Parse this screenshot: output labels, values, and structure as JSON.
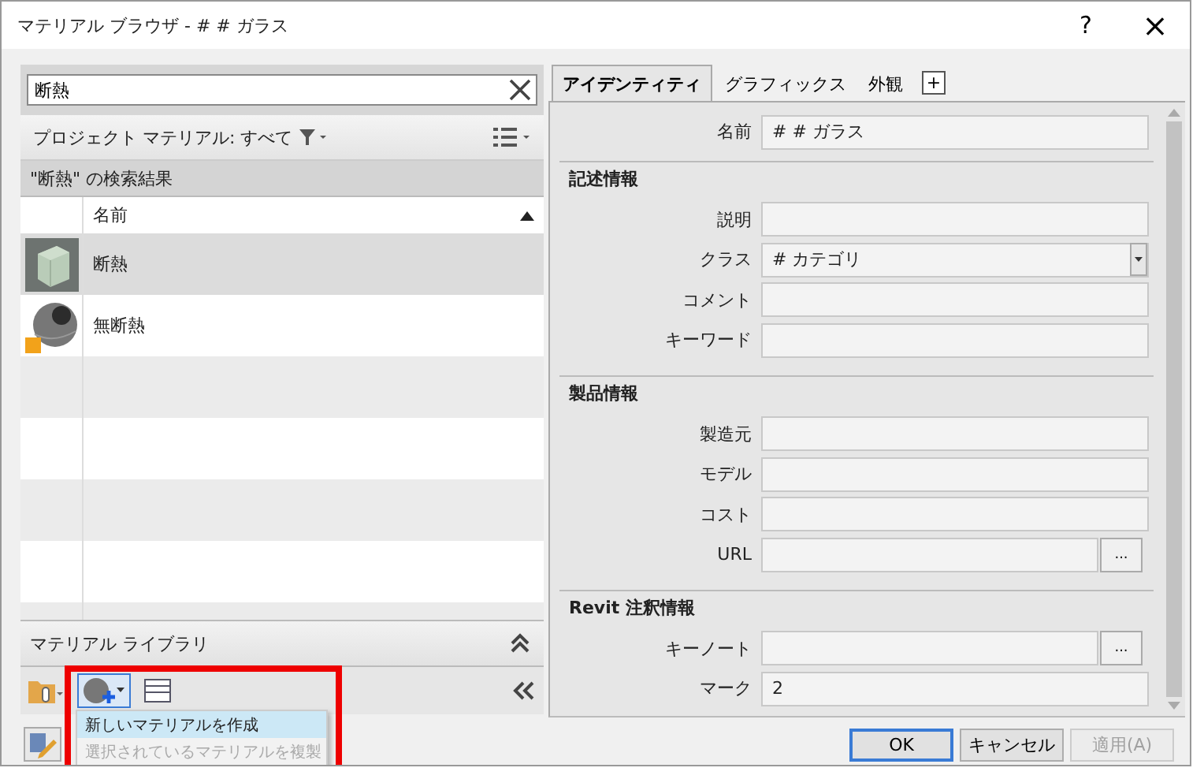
{
  "window": {
    "title": "マテリアル ブラウザ - # # ガラス",
    "help": "?",
    "close": "×"
  },
  "search": {
    "value": "断熱"
  },
  "filter": {
    "label": "プロジェクト マテリアル: すべて"
  },
  "results_header": "\"断熱\" の検索結果",
  "table": {
    "columns": [
      "名前"
    ],
    "rows": [
      {
        "name": "断熱",
        "kind": "cube",
        "selected": true
      },
      {
        "name": "無断熱",
        "kind": "sphere",
        "selected": false
      }
    ]
  },
  "library": {
    "title": "マテリアル ライブラリ"
  },
  "create_menu": {
    "items": [
      {
        "label": "新しいマテリアルを作成",
        "selected": true,
        "disabled": false
      },
      {
        "label": "選択されているマテリアルを複製",
        "selected": false,
        "disabled": true
      }
    ]
  },
  "tabs": [
    {
      "label": "アイデンティティ",
      "selected": true
    },
    {
      "label": "グラフィックス",
      "selected": false
    },
    {
      "label": "外観",
      "selected": false
    }
  ],
  "add_tab": "+",
  "properties": {
    "name": {
      "label": "名前",
      "value": "# # ガラス"
    },
    "sections": [
      {
        "title": "記述情報",
        "fields": [
          {
            "label": "説明",
            "kind": "text"
          },
          {
            "label": "クラス",
            "kind": "dropdown",
            "value": "# カテゴリ"
          },
          {
            "label": "コメント",
            "kind": "text"
          },
          {
            "label": "キーワード",
            "kind": "text"
          }
        ]
      },
      {
        "title": "製品情報",
        "fields": [
          {
            "label": "製造元",
            "kind": "text"
          },
          {
            "label": "モデル",
            "kind": "text"
          },
          {
            "label": "コスト",
            "kind": "text"
          },
          {
            "label": "URL",
            "kind": "browse",
            "button": "..."
          }
        ]
      },
      {
        "title": "Revit 注釈情報",
        "fields": [
          {
            "label": "キーノート",
            "kind": "browse",
            "button": "..."
          },
          {
            "label": "マーク",
            "kind": "text",
            "value": "2"
          }
        ]
      }
    ]
  },
  "buttons": [
    {
      "label": "OK",
      "disabled": false
    },
    {
      "label": "キャンセル",
      "disabled": false
    },
    {
      "label": "適用(A)",
      "disabled": true
    }
  ]
}
